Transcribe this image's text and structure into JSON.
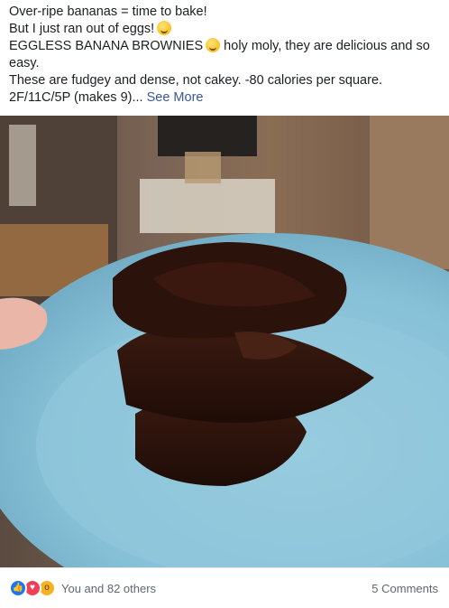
{
  "post": {
    "lines": [
      "Over-ripe bananas = time to bake!",
      "But I just ran out of eggs!",
      "EGGLESS BANANA BROWNIES",
      " holy moly, they are delicious and so easy.",
      "These are fudgey and dense, not cakey. -80 calories per square.",
      "2F/11C/5P (makes 9)..."
    ],
    "see_more": "See More",
    "emoji_1": "tongue-face-emoji",
    "emoji_2": "smirk-face-emoji"
  },
  "photo": {
    "subject": "stacked-brownies-on-blue-plate",
    "plate_color": "#8fc6dc",
    "brownie_color": "#2a120b"
  },
  "footer": {
    "reaction_icons": [
      "like-icon",
      "love-icon",
      "wow-icon"
    ],
    "reaction_text": "You and 82 others",
    "comments": "5 Comments"
  }
}
